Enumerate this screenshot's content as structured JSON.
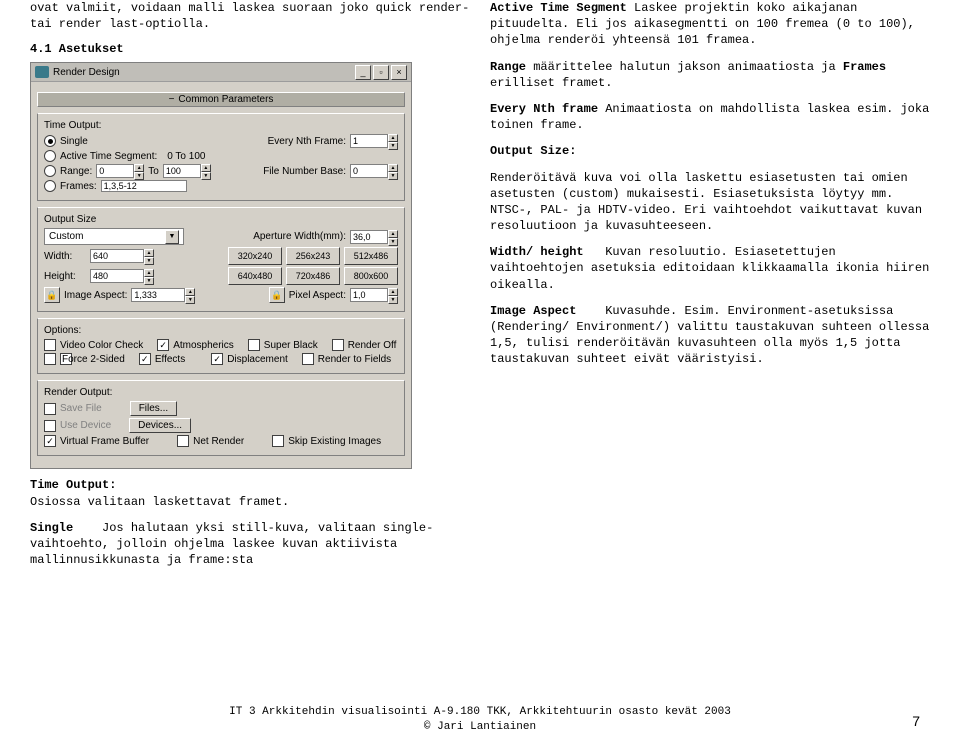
{
  "left_para1": "ovat valmiit, voidaan malli laskea suoraan joko quick render- tai render last-optiolla.",
  "heading_left": "4.1  Asetukset",
  "dialog": {
    "title": "Render Design",
    "common_params": "Common Parameters",
    "time_output_label": "Time Output:",
    "single": "Single",
    "every_nth_label": "Every Nth Frame:",
    "every_nth_val": "1",
    "active_seg": "Active Time Segment:",
    "active_seg_range": "0 To 100",
    "range_label": "Range:",
    "range_from": "0",
    "range_to_label": "To",
    "range_to": "100",
    "file_num_base_label": "File Number Base:",
    "file_num_base_val": "0",
    "frames_label": "Frames:",
    "frames_val": "1,3,5-12",
    "output_size_label": "Output Size",
    "dropdown_val": "Custom",
    "aperture_label": "Aperture Width(mm):",
    "aperture_val": "36,0",
    "width_label": "Width:",
    "width_val": "640",
    "height_label": "Height:",
    "height_val": "480",
    "btns": [
      "320x240",
      "256x243",
      "512x486",
      "640x480",
      "720x486",
      "800x600"
    ],
    "img_aspect_label": "Image Aspect:",
    "img_aspect_val": "1,333",
    "pix_aspect_label": "Pixel Aspect:",
    "pix_aspect_val": "1,0",
    "options_label": "Options:",
    "opt_video": "Video Color Check",
    "opt_atmo": "Atmospherics",
    "opt_super": "Super Black",
    "opt_roff": "Render Off",
    "opt_force": "Force 2-Sided",
    "opt_effects": "Effects",
    "opt_disp": "Displacement",
    "opt_fields": "Render to Fields",
    "render_output_label": "Render Output:",
    "save_file": "Save File",
    "files_btn": "Files...",
    "use_device": "Use Device",
    "devices_btn": "Devices...",
    "vfb": "Virtual Frame Buffer",
    "net_render": "Net Render",
    "skip": "Skip Existing Images"
  },
  "left_to_head": "Time Output:",
  "left_to_body": "Osiossa valitaan laskettavat framet.",
  "left_single_head": "Single",
  "left_single_body": "    Jos halutaan yksi still-kuva, valitaan single-vaihtoehto, jolloin ohjelma laskee kuvan aktiivista mallinnusikkunasta ja frame:sta",
  "r1_head": "Active Time Segment ",
  "r1_body": "Laskee projektin koko aikajanan pituudelta. Eli jos aikasegmentti on 100 fremea (0 to 100), ohjelma renderöi yhteensä 101 framea.",
  "r2_head": "Range",
  "r2_body": " määrittelee halutun jakson animaatiosta ja ",
  "r2_head2": "Frames",
  "r2_body2": " erilliset framet.",
  "r3_head": "Every Nth frame ",
  "r3_body": "Animaatiosta on mahdollista laskea esim. joka toinen frame.",
  "r4_head": "Output Size:",
  "r5_body": "Renderöitävä kuva voi olla laskettu esiasetusten tai omien asetusten (custom) mukaisesti. Esiasetuksista löytyy mm. NTSC-, PAL- ja HDTV-video. Eri vaihtoehdot vaikuttavat kuvan resoluutioon ja kuvasuhteeseen.",
  "r6_head": "Width/ height",
  "r6_body": "   Kuvan resoluutio. Esiasetettujen vaihtoehtojen asetuksia editoidaan klikkaamalla ikonia hiiren oikealla.",
  "r7_head": "Image Aspect",
  "r7_body": "    Kuvasuhde. Esim. Environment-asetuksissa (Rendering/ Environment/) valittu taustakuvan suhteen ollessa 1,5, tulisi renderöitävän kuvasuhteen olla myös 1,5 jotta taustakuvan suhteet eivät vääristyisi.",
  "footer_line1": "IT 3 Arkkitehdin visualisointi A-9.180  TKK, Arkkitehtuurin osasto kevät 2003",
  "footer_line2": "©  Jari Lantiainen",
  "page_num": "7"
}
